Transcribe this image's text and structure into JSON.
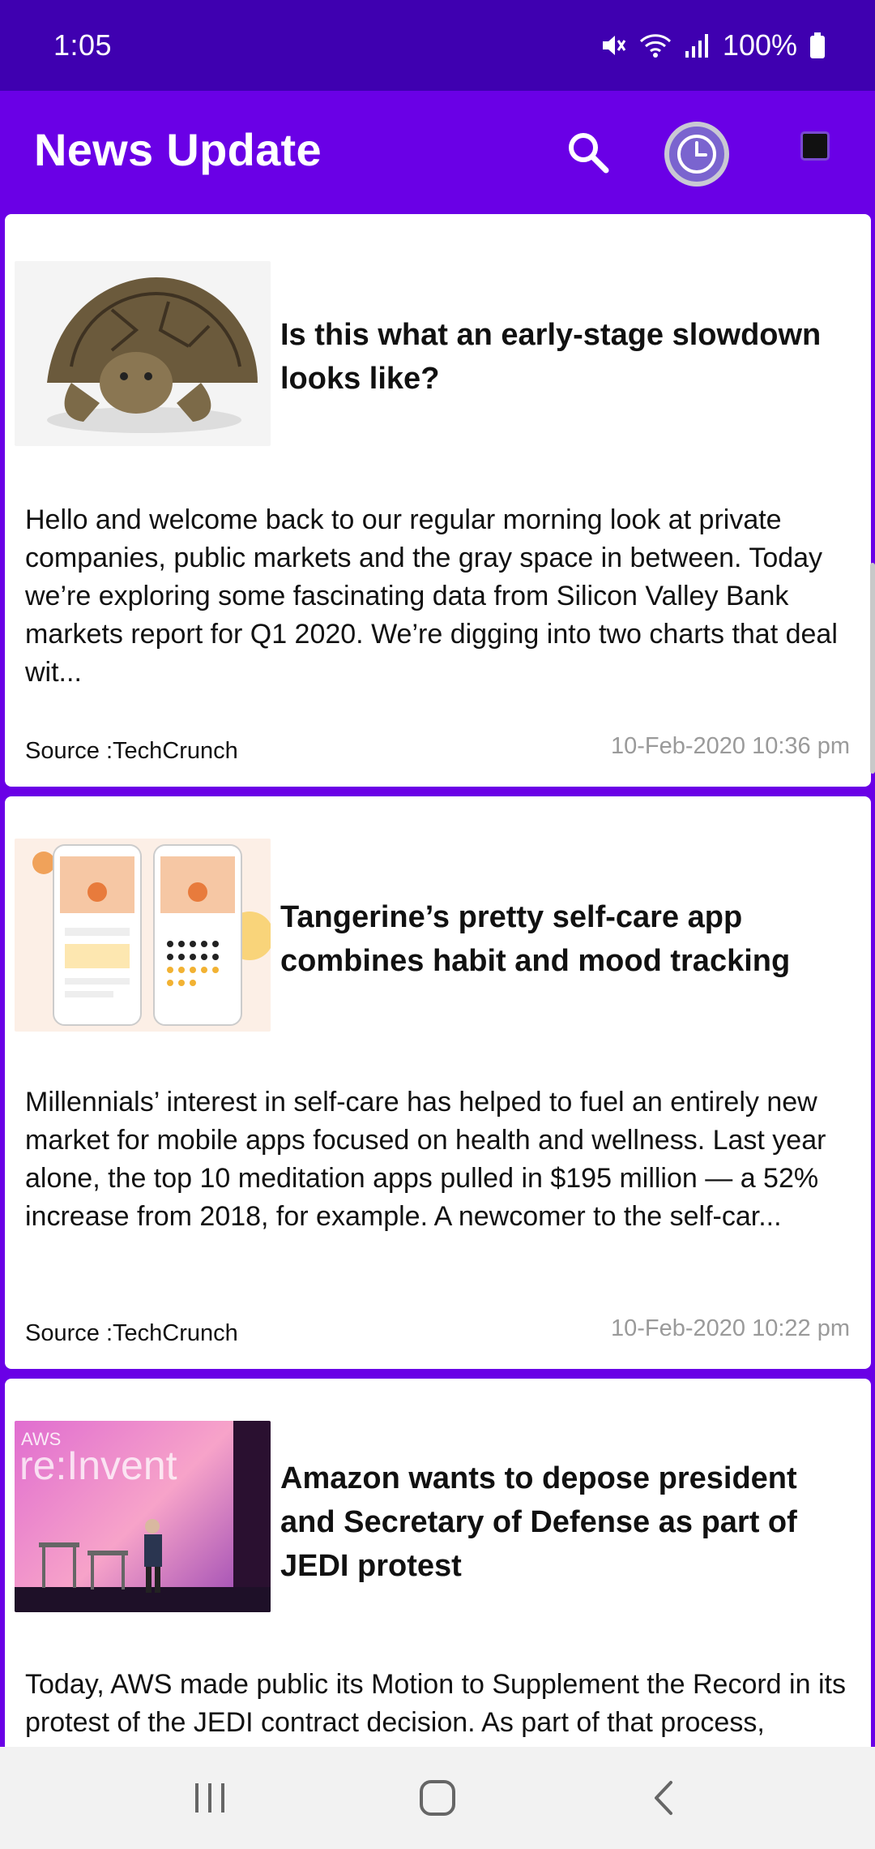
{
  "status_bar": {
    "time": "1:05",
    "battery": "100%",
    "icons": [
      "mute-icon",
      "wifi-icon",
      "signal-icon",
      "battery-icon"
    ]
  },
  "app_bar": {
    "title": "News Update",
    "actions": [
      "search-icon",
      "history-icon",
      "stop-icon"
    ]
  },
  "articles": [
    {
      "title": "Is this what an early-stage slowdown looks like?",
      "description": "Hello and welcome back to our regular morning look at private companies, public markets and the gray space in between. Today we’re exploring some fascinating data from Silicon Valley Bank markets report for Q1 2020. We’re digging into two charts that deal wit...",
      "source": "Source :TechCrunch",
      "date": "10-Feb-2020 10:36 pm",
      "image": "tortoise-photo"
    },
    {
      "title": "Tangerine’s pretty self-care app combines habit and mood tracking",
      "description": "Millennials’ interest in self-care has helped to fuel an entirely new market for mobile apps focused on health and wellness. Last year alone, the top 10 meditation apps pulled in $195 million — a 52% increase from 2018, for example. A newcomer to the self-car...",
      "source": "Source :TechCrunch",
      "date": "10-Feb-2020 10:22 pm",
      "image": "app-screens-photo"
    },
    {
      "title": "Amazon wants to depose president and Secretary of Defense as part of JEDI protest",
      "description": "Today, AWS made public its Motion to Supplement the Record in its protest of the JEDI contract decision. As part of that process,",
      "image": "aws-reinvent-photo",
      "image_text": [
        "AWS",
        "re:Invent"
      ]
    }
  ],
  "nav_bar": {
    "buttons": [
      "recents-icon",
      "home-icon",
      "back-icon"
    ]
  }
}
